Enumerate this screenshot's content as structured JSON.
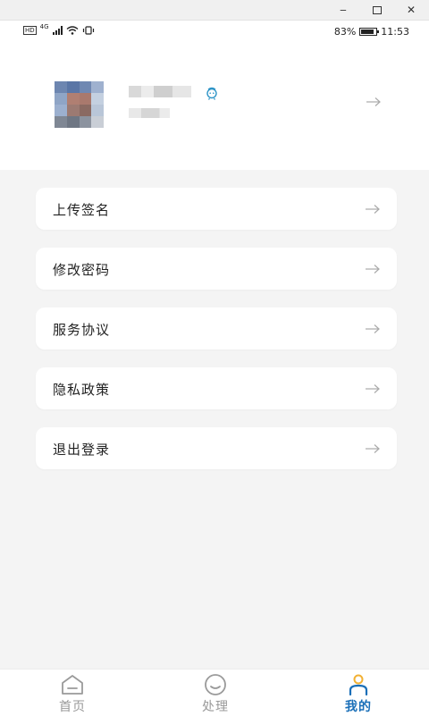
{
  "window": {
    "minimize_glyph": "‒",
    "close_glyph": "✕"
  },
  "status_bar": {
    "network_type": "4G",
    "hd_badge": "HD",
    "battery_percent": "83%",
    "battery_level": 0.83,
    "time": "11:53"
  },
  "profile": {
    "name": "",
    "id": "",
    "gender_icon": "male-icon",
    "arrow_icon": "arrow-right-icon"
  },
  "menu": {
    "items": [
      {
        "label": "上传签名",
        "icon": "arrow-right-icon"
      },
      {
        "label": "修改密码",
        "icon": "arrow-right-icon"
      },
      {
        "label": "服务协议",
        "icon": "arrow-right-icon"
      },
      {
        "label": "隐私政策",
        "icon": "arrow-right-icon"
      },
      {
        "label": "退出登录",
        "icon": "arrow-right-icon"
      }
    ]
  },
  "tabbar": {
    "tabs": [
      {
        "label": "首页",
        "icon": "home-icon",
        "active": false
      },
      {
        "label": "处理",
        "icon": "smile-icon",
        "active": false
      },
      {
        "label": "我的",
        "icon": "user-icon",
        "active": true
      }
    ]
  },
  "colors": {
    "accent": "#1a6fb8",
    "active_icon": "#f2b134",
    "inactive": "#999999",
    "background": "#f4f4f4",
    "card": "#ffffff"
  }
}
